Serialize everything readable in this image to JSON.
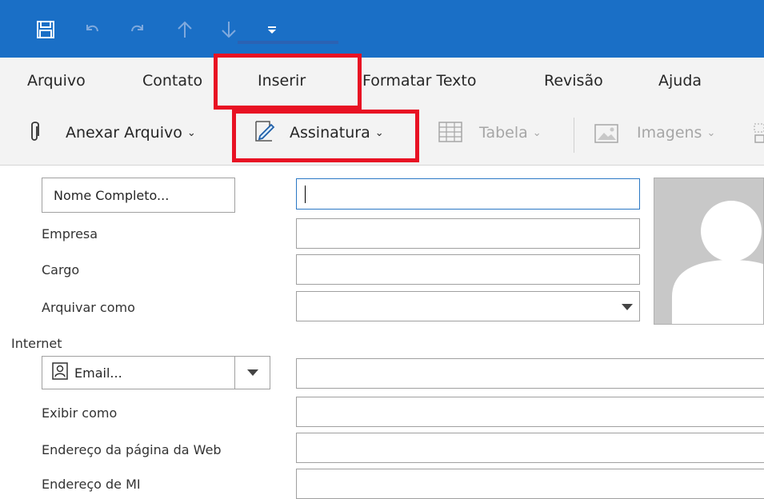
{
  "quick_access": {
    "icons": [
      "save-icon",
      "undo-icon",
      "redo-icon",
      "up-arrow-icon",
      "down-arrow-icon",
      "customize-toolbar-icon"
    ]
  },
  "tabs": [
    "Arquivo",
    "Contato",
    "Inserir",
    "Formatar Texto",
    "Revisão",
    "Ajuda"
  ],
  "active_tab": "Inserir",
  "ribbon": {
    "attach_label": "Anexar Arquivo",
    "signature_label": "Assinatura",
    "table_label": "Tabela",
    "images_label": "Imagens",
    "caret": "⌄"
  },
  "form": {
    "full_name_button": "Nome Completo...",
    "company_label": "Empresa",
    "job_label": "Cargo",
    "file_as_label": "Arquivar como",
    "internet_label": "Internet",
    "email_button": "Email...",
    "display_as_label": "Exibir como",
    "webpage_label": "Endereço da página da Web",
    "im_label": "Endereço de MI"
  },
  "colors": {
    "title_bar": "#1a6fc6",
    "highlight": "#e81123",
    "tab_underline": "#2b62b3"
  }
}
